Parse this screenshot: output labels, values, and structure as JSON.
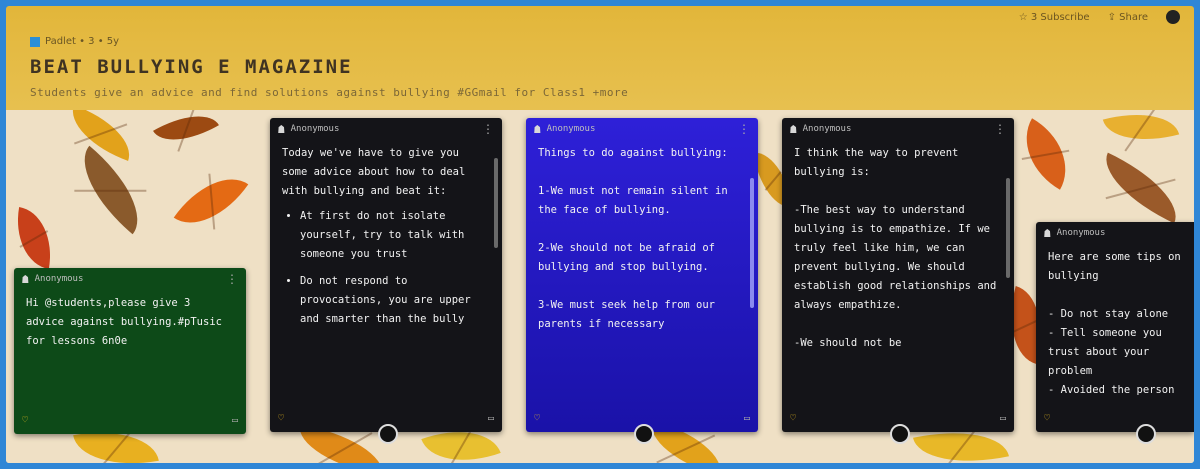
{
  "topbar": {
    "items": [
      "☆ 3 Subscribe",
      "⇪ Share"
    ]
  },
  "breadcrumb": "Padlet • 3 • 5y",
  "page": {
    "title": "BEAT BULLYING E MAGAZINE",
    "subtitle": "Students give an advice and find solutions against bullying #GGmail for Class1 +more"
  },
  "posts": [
    {
      "author": "Anonymous",
      "body": "Hi @students,please give 3 advice against bullying.#pTusic for lessons 6n0e",
      "bg": "#0d4a18"
    },
    {
      "author": "Anonymous",
      "intro": "Today we've have to give you some advice about how to deal with bullying and beat it:",
      "bullets": [
        "At first do not isolate yourself, try to talk with someone you trust",
        "Do not respond to provocations, you are upper and smarter than the bully"
      ],
      "bg": "#141418"
    },
    {
      "author": "Anonymous",
      "body": "Things to do against bullying:\n\n1-We must not remain silent in the face of bullying.\n\n2-We should not be afraid of bullying and stop bullying.\n\n3-We must seek help from our parents if necessary",
      "bg": "#2518c8"
    },
    {
      "author": "Anonymous",
      "body": "I think the way to prevent bullying is:\n\n-The best way to understand bullying is to empathize. If we truly feel like him, we can prevent bullying. We should establish good relationships and always empathize.\n\n-We should not be",
      "bg": "#141418"
    },
    {
      "author": "Anonymous",
      "body": "Here are some tips on bullying\n\n- Do not stay alone\n- Tell someone you trust about your problem\n- Avoided the person",
      "bg": "#141418"
    }
  ],
  "colors": {
    "accent": "#2a8fd8",
    "frame": "#2f86d6"
  }
}
